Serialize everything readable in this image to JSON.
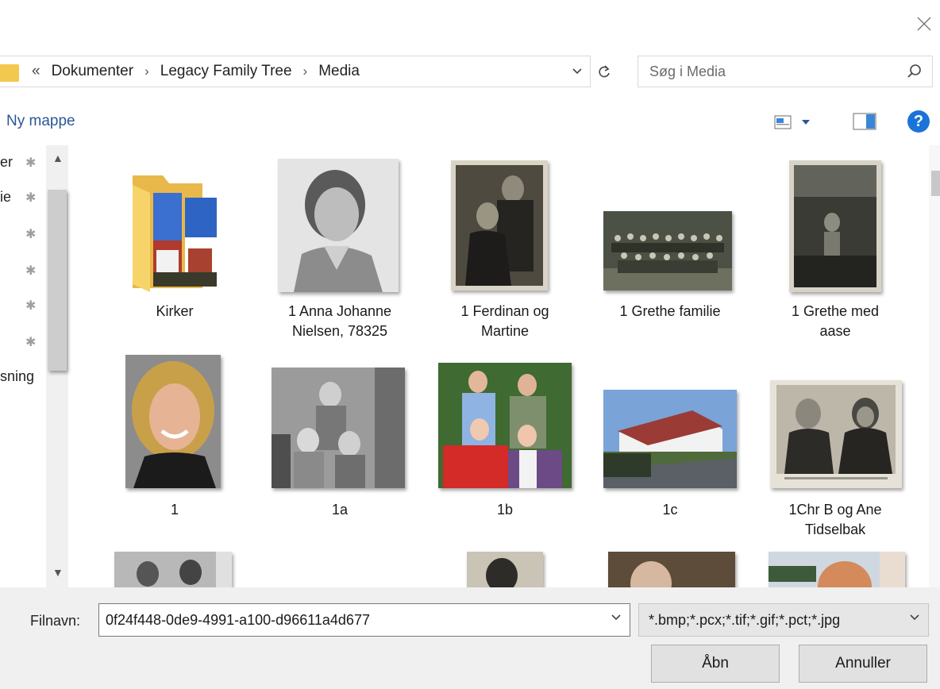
{
  "dialog": {
    "close_label": "×"
  },
  "address_bar": {
    "overflow": "«",
    "crumbs": [
      "Dokumenter",
      "Legacy Family Tree",
      "Media"
    ],
    "separator": "›"
  },
  "search": {
    "placeholder": "Søg i Media"
  },
  "toolbar": {
    "new_folder_label": "Ny mappe",
    "help_label": "?"
  },
  "nav_pane": {
    "items": [
      {
        "label": "er",
        "pinned": true
      },
      {
        "label": "ie",
        "pinned": true
      },
      {
        "label": "",
        "pinned": true
      },
      {
        "label": "",
        "pinned": true
      },
      {
        "label": "",
        "pinned": true
      },
      {
        "label": "",
        "pinned": true
      },
      {
        "label": "sning",
        "pinned": false
      }
    ]
  },
  "files": [
    {
      "name": "Kirker",
      "type": "folder"
    },
    {
      "name": "1 Anna Johanne Nielsen, 78325",
      "type": "image"
    },
    {
      "name": "1 Ferdinan og Martine",
      "type": "image"
    },
    {
      "name": "1 Grethe familie",
      "type": "image"
    },
    {
      "name": "1 Grethe med aase",
      "type": "image"
    },
    {
      "name": "1",
      "type": "image"
    },
    {
      "name": "1a",
      "type": "image"
    },
    {
      "name": "1b",
      "type": "image"
    },
    {
      "name": "1c",
      "type": "image"
    },
    {
      "name": "1Chr B og Ane Tidselbak",
      "type": "image"
    }
  ],
  "file_labels": {
    "kirker": "Kirker",
    "anna_l1": "1 Anna Johanne",
    "anna_l2": "Nielsen, 78325",
    "ferd_l1": "1 Ferdinan og",
    "ferd_l2": "Martine",
    "grethe_fam": "1 Grethe familie",
    "grethe_aase_l1": "1 Grethe med",
    "grethe_aase_l2": "aase",
    "one": "1",
    "one_a": "1a",
    "one_b": "1b",
    "one_c": "1c",
    "chr_l1": "1Chr B og Ane",
    "chr_l2": "Tidselbak"
  },
  "footer": {
    "filename_label": "Filnavn:",
    "filename_value": "0f24f448-0de9-4991-a100-d96611a4d677",
    "filter_value": "*.bmp;*.pcx;*.tif;*.gif;*.pct;*.jpg",
    "open_label": "Åbn",
    "cancel_label": "Annuller"
  },
  "colors": {
    "accent_link": "#2b5797",
    "help_blue": "#1a73d9",
    "folder_yellow": "#f3c84e"
  }
}
